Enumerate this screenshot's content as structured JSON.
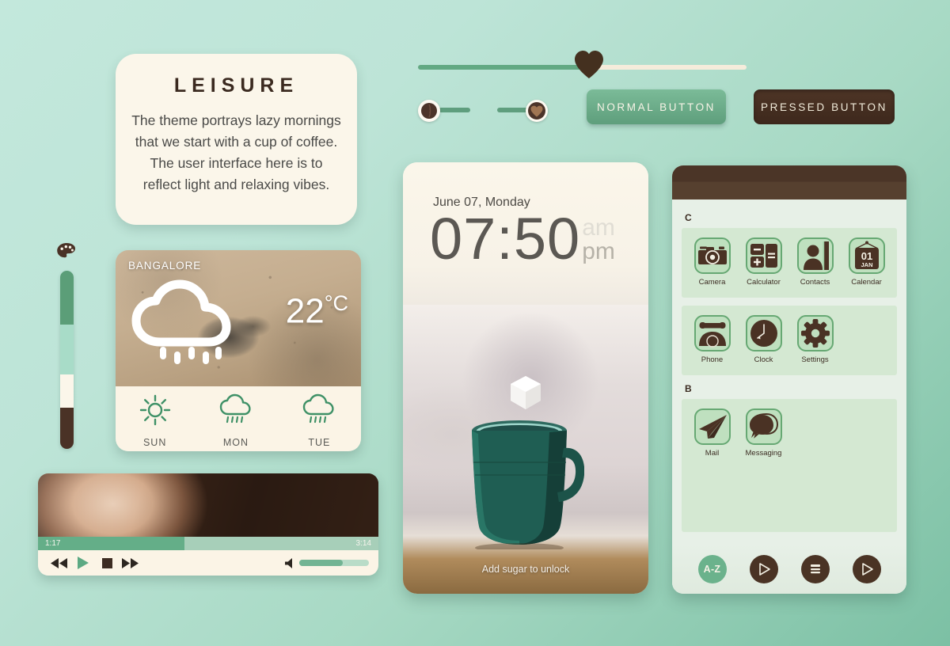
{
  "theme": {
    "name": "LEISURE",
    "colors": {
      "green": "#5f9e7e",
      "mint": "#a8dcc8",
      "cream": "#faf5e9",
      "brown": "#4a3226",
      "bg_top": "#c3e8dc",
      "bg_bottom": "#7cc0a4"
    }
  },
  "leisure_card": {
    "title": "LEISURE",
    "body": "The theme portrays lazy mornings that we start with a cup of coffee. The user interface here is to reflect light and relaxing vibes."
  },
  "color_slider": {
    "icon": "palette-icon",
    "segments": [
      {
        "name": "green",
        "color": "#5b9e78",
        "pct": 30
      },
      {
        "name": "mint",
        "color": "#a8dcc8",
        "pct": 28
      },
      {
        "name": "cream",
        "color": "#fbf6ea",
        "pct": 19
      },
      {
        "name": "brown",
        "color": "#4a3226",
        "pct": 23
      }
    ]
  },
  "main_slider": {
    "value_pct": 52,
    "thumb_icon": "heart-icon",
    "fill_color": "#62a983",
    "track_color": "#f5ecdb"
  },
  "toggles": [
    {
      "name": "toggle-off",
      "state": "off",
      "knob_icon": "coffee-bean-icon"
    },
    {
      "name": "toggle-on",
      "state": "on",
      "knob_icon": "heart-icon"
    }
  ],
  "buttons": {
    "normal_label": "NORMAL BUTTON",
    "pressed_label": "PRESSED BUTTON"
  },
  "weather": {
    "city": "BANGALORE",
    "temperature": "22",
    "degree_unit": "°C",
    "condition_icon": "rain-cloud-icon",
    "forecast": [
      {
        "day": "SUN",
        "icon": "sun-icon"
      },
      {
        "day": "MON",
        "icon": "rain-cloud-icon"
      },
      {
        "day": "TUE",
        "icon": "rain-cloud-icon"
      }
    ]
  },
  "media_player": {
    "elapsed": "1:17",
    "total": "3:14",
    "progress_pct": 43,
    "volume_pct": 62,
    "controls": [
      {
        "name": "rewind-button",
        "icon": "rewind-icon"
      },
      {
        "name": "play-button",
        "icon": "play-icon"
      },
      {
        "name": "stop-button",
        "icon": "stop-icon"
      },
      {
        "name": "fast-forward-button",
        "icon": "fast-forward-icon"
      }
    ],
    "volume_icon": "speaker-icon"
  },
  "lockscreen": {
    "date": "June 07, Monday",
    "time": "07:50",
    "am_label": "am",
    "pm_label": "pm",
    "hint": "Add sugar to unlock",
    "unlock_token_icon": "sugar-cube-icon"
  },
  "app_drawer": {
    "sections": [
      {
        "letter": "C",
        "groups": [
          {
            "apps": [
              {
                "label": "Camera",
                "icon": "camera-icon"
              },
              {
                "label": "Calculator",
                "icon": "calculator-icon"
              },
              {
                "label": "Contacts",
                "icon": "contacts-icon"
              },
              {
                "label": "Calendar",
                "icon": "calendar-icon",
                "day": "01",
                "month": "JAN"
              }
            ]
          },
          {
            "apps": [
              {
                "label": "Phone",
                "icon": "phone-icon"
              },
              {
                "label": "Clock",
                "icon": "clock-icon"
              },
              {
                "label": "Settings",
                "icon": "gear-icon"
              }
            ]
          }
        ]
      },
      {
        "letter": "B",
        "groups": [
          {
            "apps": [
              {
                "label": "Mail",
                "icon": "paper-plane-icon"
              },
              {
                "label": "Messaging",
                "icon": "speech-bubble-icon"
              }
            ]
          }
        ]
      }
    ],
    "dock": [
      {
        "name": "az-sort-button",
        "label": "A-Z",
        "icon": "az-icon",
        "style": "green"
      },
      {
        "name": "play-store-button",
        "label": "",
        "icon": "play-icon",
        "style": "brown"
      },
      {
        "name": "list-button",
        "label": "",
        "icon": "list-icon",
        "style": "brown"
      },
      {
        "name": "play-button-2",
        "label": "",
        "icon": "play-icon",
        "style": "brown"
      }
    ]
  }
}
